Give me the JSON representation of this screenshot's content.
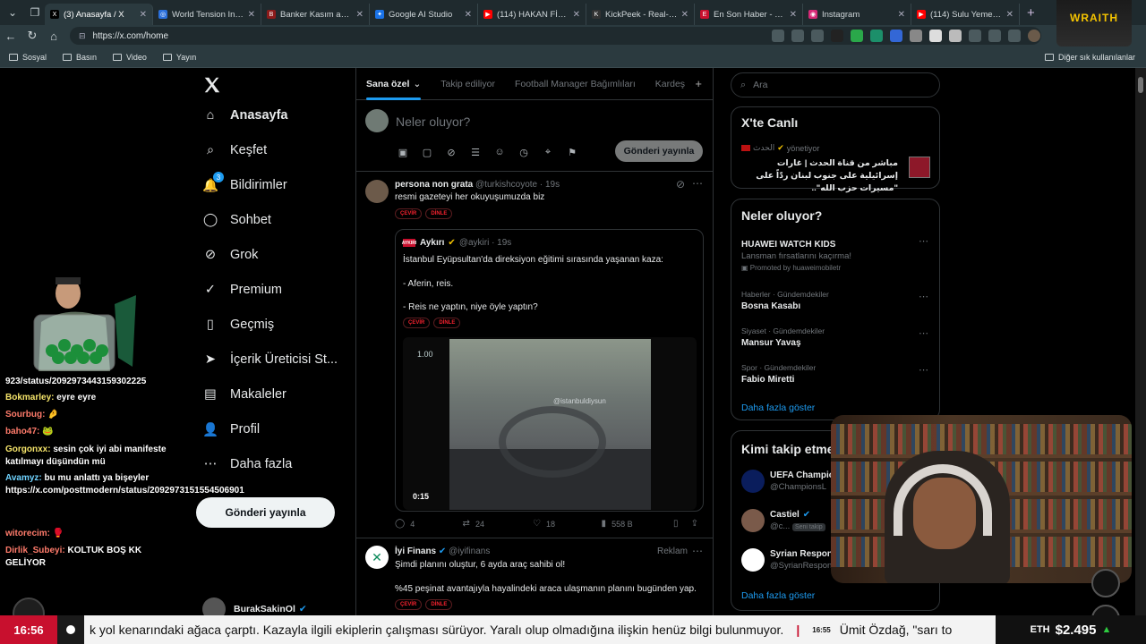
{
  "browser": {
    "tabs": [
      {
        "title": "(3) Anasayfa / X",
        "active": true,
        "fav": "X",
        "color": "#000000"
      },
      {
        "title": "World Tension Index —",
        "fav": "◎",
        "color": "#2a6fdb"
      },
      {
        "title": "Banker Kasım aydınlat",
        "fav": "B",
        "color": "#8b1a1a"
      },
      {
        "title": "Google AI Studio",
        "fav": "✦",
        "color": "#1a73e8"
      },
      {
        "title": "(114) HAKAN FİDAN M",
        "fav": "▶",
        "color": "#ff0000"
      },
      {
        "title": "KickPeek - Real-time U",
        "fav": "K",
        "color": "#333333"
      },
      {
        "title": "En Son Haber - Haberle",
        "fav": "E",
        "color": "#c8102e"
      },
      {
        "title": "Instagram",
        "fav": "◉",
        "color": "#d62976"
      },
      {
        "title": "(114) Sulu Yemekler de",
        "fav": "▶",
        "color": "#ff0000"
      }
    ],
    "url": "https://x.com/home",
    "bookmarks": [
      "Sosyal",
      "Basın",
      "Video",
      "Yayın"
    ],
    "other_bookmarks": "Diğer sık kullanılanlar"
  },
  "nav": {
    "items": [
      {
        "label": "Anasayfa",
        "icon": "home-icon",
        "glyph": "⌂"
      },
      {
        "label": "Keşfet",
        "icon": "search-icon",
        "glyph": "⌕"
      },
      {
        "label": "Bildirimler",
        "icon": "bell-icon",
        "glyph": "🔔"
      },
      {
        "label": "Sohbet",
        "icon": "chat-icon",
        "glyph": "◯"
      },
      {
        "label": "Grok",
        "icon": "grok-icon",
        "glyph": "⊘"
      },
      {
        "label": "Premium",
        "icon": "verified-icon",
        "glyph": "✓"
      },
      {
        "label": "Geçmiş",
        "icon": "bookmark-icon",
        "glyph": "▯"
      },
      {
        "label": "İçerik Üreticisi St...",
        "icon": "rocket-icon",
        "glyph": "➤"
      },
      {
        "label": "Makaleler",
        "icon": "article-icon",
        "glyph": "▤"
      },
      {
        "label": "Profil",
        "icon": "profile-icon",
        "glyph": "👤"
      },
      {
        "label": "Daha fazla",
        "icon": "more-icon",
        "glyph": "⋯"
      }
    ],
    "notification_count": "3",
    "post_button": "Gönderi yayınla",
    "account_name": "BurakSakinOl"
  },
  "feed": {
    "tabs": [
      "Sana özel",
      "Takip ediliyor",
      "Football Manager Bağımlıları",
      "Kardeş"
    ],
    "compose_placeholder": "Neler oluyor?",
    "compose_post": "Gönderi yayınla",
    "tweet1": {
      "name": "persona non grata",
      "handle": "@turkishcoyote · 19s",
      "text": "resmi gazeteyi her okuyuşumuzda biz",
      "pills": [
        "ÇEVİR",
        "DİNLE"
      ],
      "quote": {
        "name": "Aykırı",
        "handle": "@aykiri · 19s",
        "logo": "AYKIRI",
        "lines": [
          "İstanbul Eyüpsultan'da direksiyon eğitimi sırasında yaşanan kaza:",
          "- Aferin, reis.",
          "- Reis ne yaptın, niye öyle yaptın?"
        ],
        "pills": [
          "ÇEVİR",
          "DİNLE"
        ],
        "video_speed": "1.00",
        "video_time": "0:15",
        "watermark": "@istanbuldiysun"
      },
      "stats": {
        "replies": "4",
        "reposts": "24",
        "likes": "18",
        "views": "558 B"
      }
    },
    "tweet2": {
      "name": "İyi Finans",
      "handle": "@iyifinans",
      "ad": "Reklam",
      "line1": "Şimdi planını oluştur, 6 ayda araç sahibi ol!",
      "line2": "%45 peşinat avantajıyla hayalindeki araca ulaşmanın planını bugünden yap.",
      "pills": [
        "ÇEVİR",
        "DİNLE"
      ]
    }
  },
  "right": {
    "search_placeholder": "Ara",
    "live": {
      "title": "X'te Canlı",
      "manager": "الحدث",
      "manager_suffix": "yönetiyor",
      "text": "مباشر من قناة الحدث | غارات إسرائيلية على جنوب لبنان ردّاً على \"مسيرات حزب الله\".."
    },
    "trends_title": "Neler oluyor?",
    "trends": [
      {
        "cat": "",
        "title": "HUAWEI WATCH KIDS",
        "sub": "Lansman fırsatlarını kaçırma!",
        "promo": "Promoted by huaweimobiletr"
      },
      {
        "cat": "Haberler · Gündemdekiler",
        "title": "Bosna Kasabı"
      },
      {
        "cat": "Siyaset · Gündemdekiler",
        "title": "Mansur Yavaş"
      },
      {
        "cat": "Spor · Gündemdekiler",
        "title": "Fabio Miretti"
      }
    ],
    "trends_more": "Daha fazla göster",
    "follow_title": "Kimi takip etme",
    "follow": [
      {
        "name": "UEFA Champio",
        "handle": "@ChampionsL"
      },
      {
        "name": "Castiel",
        "handle": "@c...",
        "tag": "Seni takip"
      },
      {
        "name": "Syrian Respon",
        "handle": "@SyrianRespon"
      }
    ],
    "follow_more": "Daha fazla göster"
  },
  "chat": [
    {
      "user": "",
      "msg": "923/status/2092973443159302225"
    },
    {
      "user": "Bokmarley:",
      "msg": "eyre eyre",
      "cls": ""
    },
    {
      "user": "Sourbug:",
      "msg": "🤌",
      "cls": "red"
    },
    {
      "user": "baho47:",
      "msg": "🐸",
      "cls": "red"
    },
    {
      "user": "Gorgonxx:",
      "msg": "sesin çok iyi abi manifeste katılmayı düşündün mü",
      "cls": ""
    },
    {
      "user": "Avamyz:",
      "msg": "bu mu anlattı ya bişeyler https://x.com/posttmodern/status/2092973151554506901",
      "cls": "cy"
    },
    {
      "user": "witorecim:",
      "msg": "🥊",
      "cls": "red"
    },
    {
      "user": "Dirlik_Subeyi:",
      "msg": "KOLTUK BOŞ KK GELİYOR",
      "cls": "red"
    }
  ],
  "overlay": {
    "brand": "WRAITH",
    "clock": "16:56",
    "news_main": "k yol kenarındaki ağaca çarptı. Kazayla ilgili ekiplerin çalışması sürüyor. Yaralı olup olmadığına ilişkin henüz bilgi bulunmuyor.",
    "news_time": "16:55",
    "news_next": "Ümit Özdağ, \"sarı to",
    "eth_label": "ETH",
    "eth_value": "$2.495",
    "eth_dir": "▲"
  }
}
